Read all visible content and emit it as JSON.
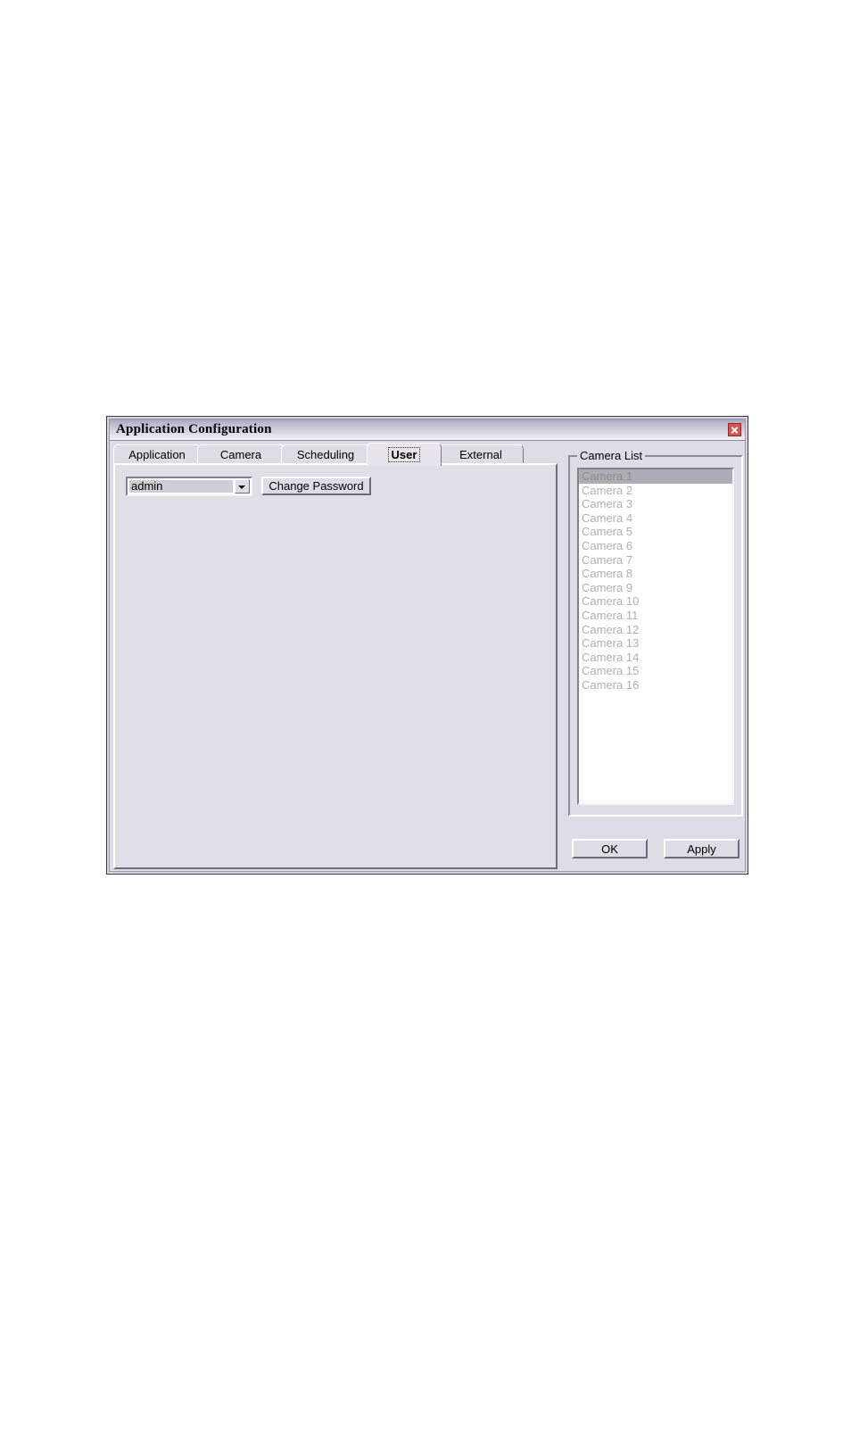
{
  "window": {
    "title": "Application Configuration",
    "close_icon": "close-icon",
    "accent_close_color": "#d9534f",
    "face_color": "#dedce4"
  },
  "tabs": [
    {
      "label": "Application",
      "selected": false
    },
    {
      "label": "Camera",
      "selected": false
    },
    {
      "label": "Scheduling",
      "selected": false
    },
    {
      "label": "User",
      "selected": true
    },
    {
      "label": "External",
      "selected": false
    }
  ],
  "user_tab": {
    "user_select": {
      "value": "admin",
      "options": [
        "admin"
      ],
      "arrow_icon": "chevron-down-icon"
    },
    "change_password_label": "Change Password"
  },
  "camera_list": {
    "title": "Camera List",
    "selected_index": 0,
    "items": [
      "Camera 1",
      "Camera 2",
      "Camera 3",
      "Camera 4",
      "Camera 5",
      "Camera 6",
      "Camera 7",
      "Camera 8",
      "Camera 9",
      "Camera 10",
      "Camera 11",
      "Camera 12",
      "Camera 13",
      "Camera 14",
      "Camera 15",
      "Camera 16"
    ]
  },
  "footer": {
    "ok_label": "OK",
    "apply_label": "Apply"
  }
}
